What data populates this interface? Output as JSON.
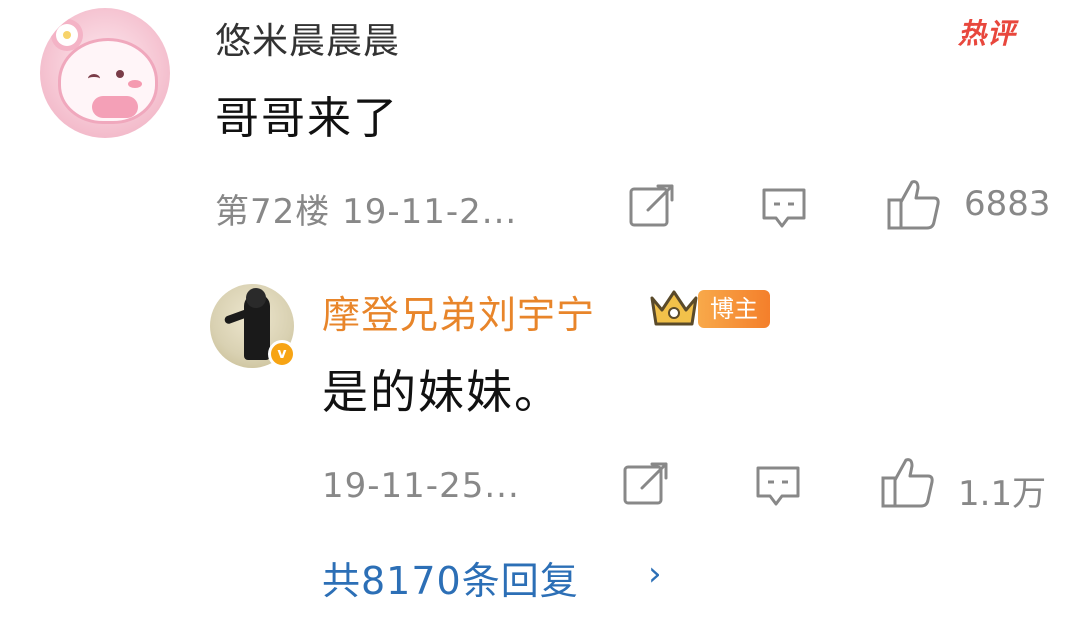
{
  "comment": {
    "username": "悠米晨晨晨",
    "hot_label": "热评",
    "text": "哥哥来了",
    "meta": "第72楼 19-11-2...",
    "likes": "6883"
  },
  "reply": {
    "username": "摩登兄弟刘宇宁",
    "badge": "博主",
    "verify_mark": "v",
    "text": "是的妹妹。",
    "meta": "19-11-25...",
    "likes": "1.1万"
  },
  "more_replies": {
    "label": "共8170条回复",
    "chevron": "›"
  },
  "icons": {
    "share": "share-icon",
    "comment": "comment-icon",
    "like": "thumbs-up-icon",
    "crown": "crown-icon",
    "verified": "verified-icon"
  },
  "colors": {
    "hot": "#e8473d",
    "reply_name": "#e8852a",
    "link": "#2c6fb6",
    "muted": "#888888"
  }
}
